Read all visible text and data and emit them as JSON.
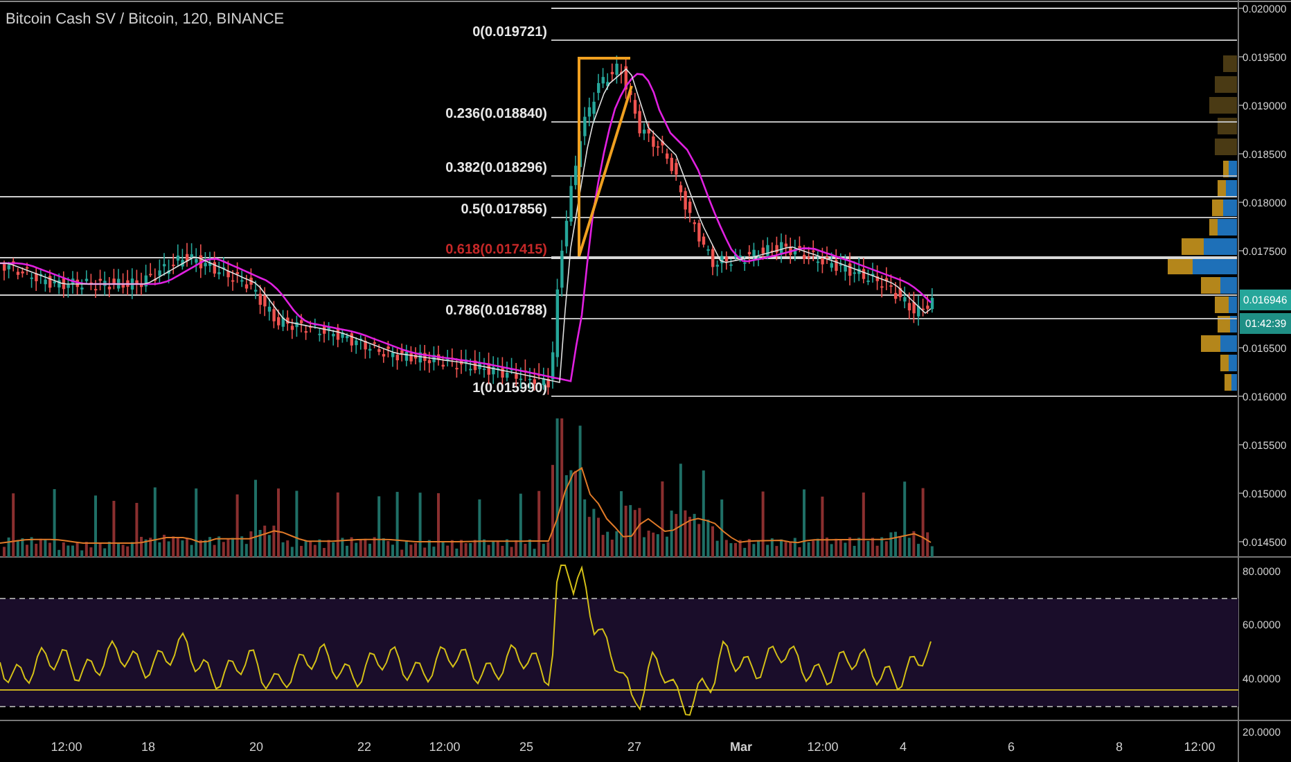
{
  "chart": {
    "title": "Bitcoin Cash SV / Bitcoin, 120, BINANCE"
  },
  "fib_levels": [
    {
      "label": "0(0.019721)",
      "kind": "normal"
    },
    {
      "label": "0.236(0.018840)",
      "kind": "normal"
    },
    {
      "label": "0.382(0.018296)",
      "kind": "normal"
    },
    {
      "label": "0.5(0.017856)",
      "kind": "normal"
    },
    {
      "label": "0.618(0.017415)",
      "kind": "accent"
    },
    {
      "label": "0.786(0.016788)",
      "kind": "normal"
    },
    {
      "label": "1(0.015990)",
      "kind": "normal"
    }
  ],
  "price_axis": [
    "0.020000",
    "0.019500",
    "0.019000",
    "0.018500",
    "0.018000",
    "0.017500",
    "0.016500",
    "0.016000",
    "0.015500",
    "0.015000",
    "0.014500"
  ],
  "price_tag": {
    "price": "0.016946",
    "countdown": "01:42:39"
  },
  "rsi_axis": [
    "80.0000",
    "60.0000",
    "40.0000",
    "20.0000"
  ],
  "time_axis": [
    {
      "label": "12:00",
      "kind": "time"
    },
    {
      "label": "18",
      "kind": "day"
    },
    {
      "label": "20",
      "kind": "day"
    },
    {
      "label": "22",
      "kind": "day"
    },
    {
      "label": "12:00",
      "kind": "time"
    },
    {
      "label": "25",
      "kind": "day"
    },
    {
      "label": "27",
      "kind": "day"
    },
    {
      "label": "Mar",
      "kind": "month"
    },
    {
      "label": "12:00",
      "kind": "time"
    },
    {
      "label": "4",
      "kind": "day"
    },
    {
      "label": "6",
      "kind": "day"
    },
    {
      "label": "8",
      "kind": "day"
    },
    {
      "label": "12:00",
      "kind": "time"
    }
  ]
}
